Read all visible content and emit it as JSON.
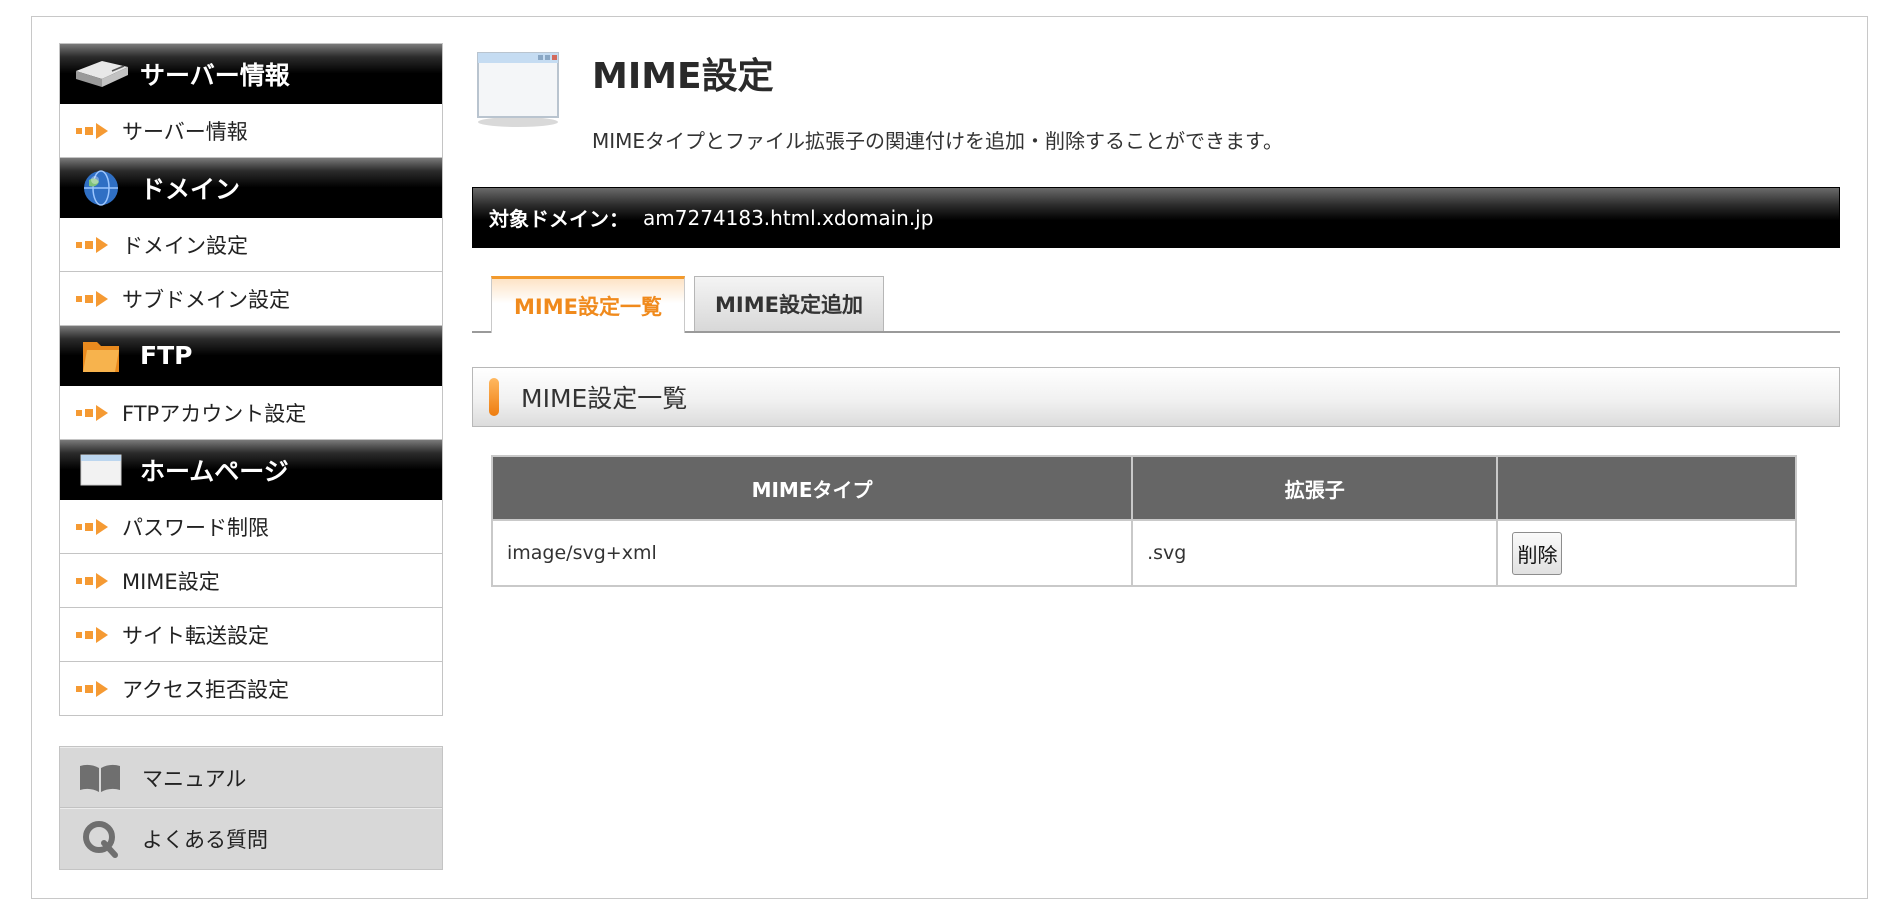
{
  "sidebar": {
    "sections": [
      {
        "title": "サーバー情報",
        "icon": "server-icon",
        "items": [
          "サーバー情報"
        ]
      },
      {
        "title": "ドメイン",
        "icon": "globe-icon",
        "items": [
          "ドメイン設定",
          "サブドメイン設定"
        ]
      },
      {
        "title": "FTP",
        "icon": "folder-icon",
        "items": [
          "FTPアカウント設定"
        ]
      },
      {
        "title": "ホームページ",
        "icon": "window-icon",
        "items": [
          "パスワード制限",
          "MIME設定",
          "サイト転送設定",
          "アクセス拒否設定"
        ]
      }
    ],
    "help": [
      {
        "label": "マニュアル",
        "icon": "book-icon"
      },
      {
        "label": "よくある質問",
        "icon": "faq-q-icon"
      }
    ]
  },
  "main": {
    "title": "MIME設定",
    "description": "MIMEタイプとファイル拡張子の関連付けを追加・削除することができます。",
    "domain_label": "対象ドメイン：",
    "domain_value": "am7274183.html.xdomain.jp",
    "tabs": [
      {
        "label": "MIME設定一覧",
        "active": true
      },
      {
        "label": "MIME設定追加",
        "active": false
      }
    ],
    "section_title": "MIME設定一覧",
    "table": {
      "headers": [
        "MIMEタイプ",
        "拡張子",
        ""
      ],
      "rows": [
        {
          "mime": "image/svg+xml",
          "ext": ".svg",
          "action": "削除"
        }
      ]
    }
  },
  "colors": {
    "accent_orange": "#f08a1c",
    "header_black": "#000000",
    "table_header": "#666666",
    "help_bg": "#d8d8d8"
  }
}
